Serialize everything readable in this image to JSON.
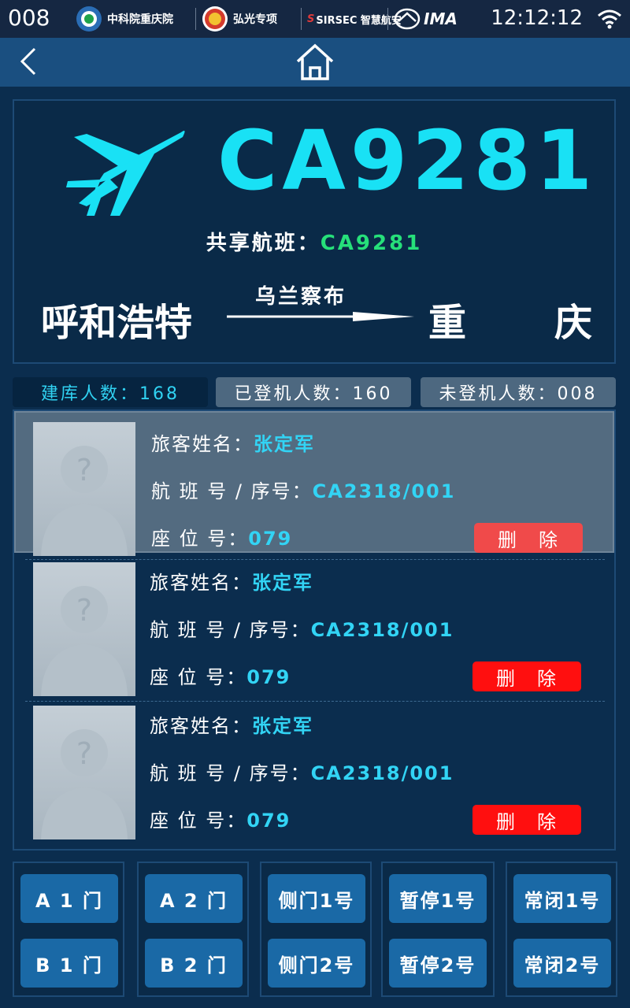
{
  "status": {
    "device_id": "008",
    "time": "12:12:12",
    "logos": [
      "中科院重庆院",
      "弘光专项",
      "SIRSEC 智慧航安",
      "IMA"
    ]
  },
  "nav": {
    "back_icon": "chevron-left-icon",
    "home_icon": "home-icon"
  },
  "flight": {
    "number": "CA9281",
    "share_label": "共享航班：",
    "share_code": "CA9281",
    "from": "呼和浩特",
    "via": "乌兰察布",
    "to_a": "重",
    "to_b": "庆"
  },
  "counts": {
    "registered": "建库人数：168",
    "boarded": "已登机人数：160",
    "not_boarded": "未登机人数：008"
  },
  "passengers": [
    {
      "name_label": "旅客姓名：",
      "name": "张定军",
      "flight_label": "航 班 号 / 序号：",
      "flight": "CA2318/001",
      "seat_label": "座 位 号：",
      "seat": "079",
      "delete": "删　除"
    },
    {
      "name_label": "旅客姓名：",
      "name": "张定军",
      "flight_label": "航 班 号 / 序号：",
      "flight": "CA2318/001",
      "seat_label": "座 位 号：",
      "seat": "079",
      "delete": "删　除"
    },
    {
      "name_label": "旅客姓名：",
      "name": "张定军",
      "flight_label": "航 班 号 / 序号：",
      "flight": "CA2318/001",
      "seat_label": "座 位 号：",
      "seat": "079",
      "delete": "删　除"
    }
  ],
  "doors": {
    "a1": "A 1 门",
    "b1": "B 1 门",
    "a2": "A 2 门",
    "b2": "B 2 门",
    "side1": "侧门1号",
    "side2": "侧门2号",
    "pause1": "暂停1号",
    "pause2": "暂停2号",
    "closed1": "常闭1号",
    "closed2": "常闭2号"
  },
  "colors": {
    "accent": "#19e1f5",
    "share": "#26e07a",
    "delete": "#ff0f0f",
    "button": "#1a69a6"
  }
}
